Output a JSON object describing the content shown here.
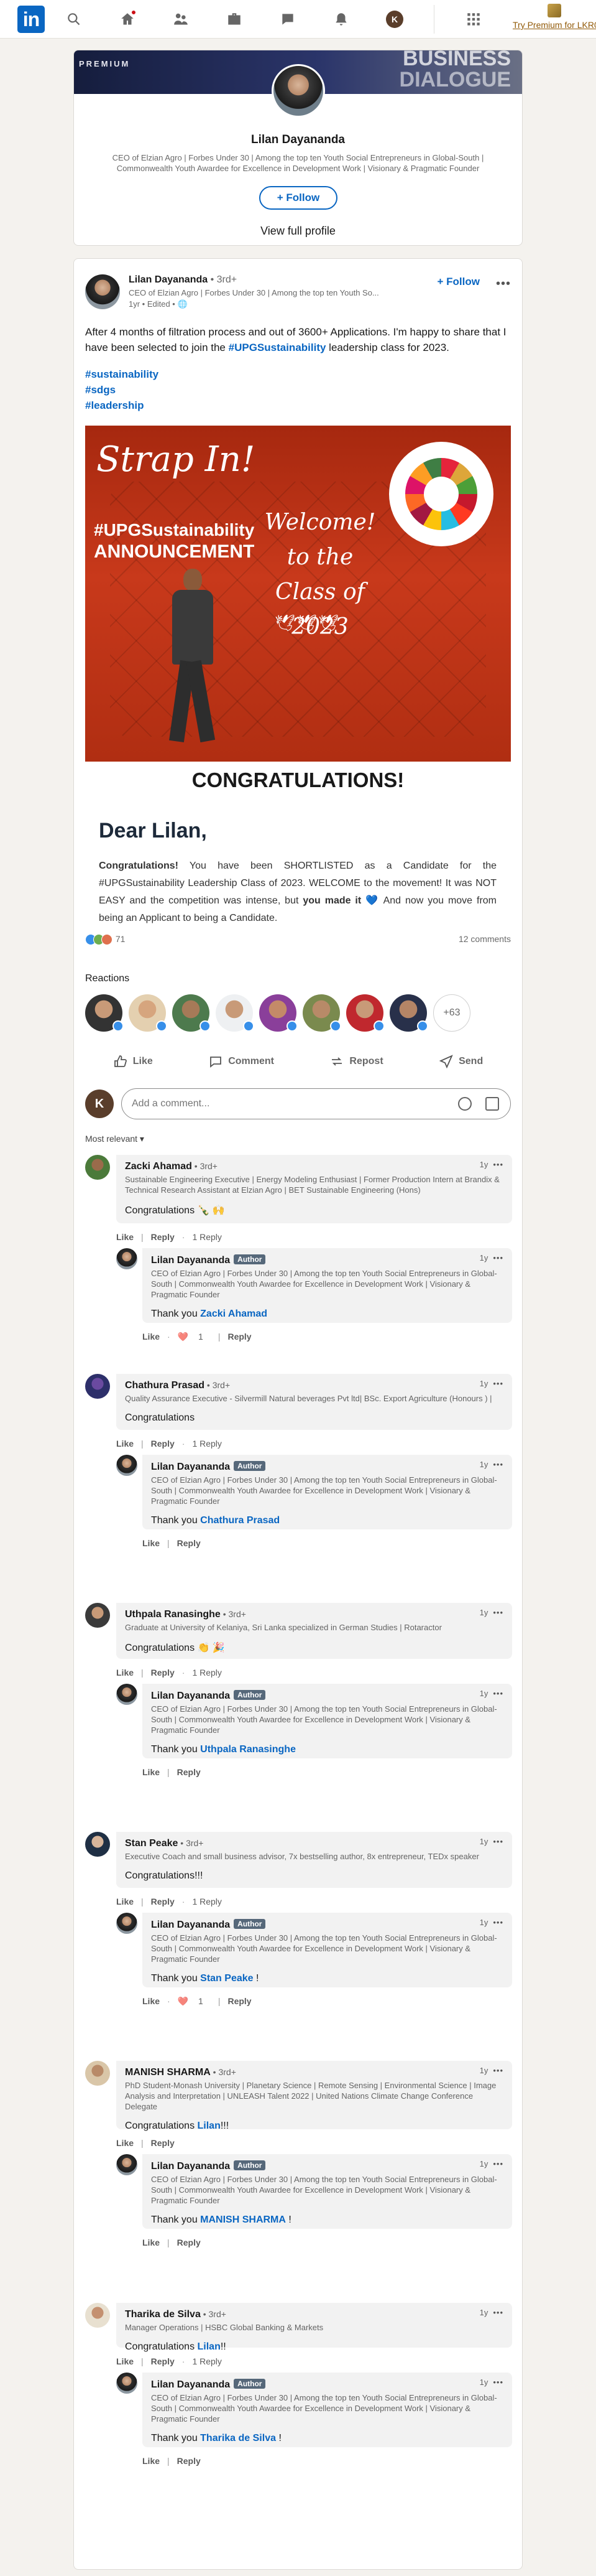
{
  "nav": {
    "logo": "in",
    "me_initial": "K",
    "premium": "Try Premium for LKR0",
    "icons": [
      "search-icon",
      "home-icon",
      "network-icon",
      "jobs-icon",
      "messaging-icon",
      "notifications-icon",
      "grid-icon"
    ]
  },
  "profile": {
    "banner_premium": "PREMIUM",
    "banner_line1": "BUSINESS",
    "banner_line2": "DIALOGUE",
    "name": "Lilan Dayananda",
    "headline": "CEO of Elzian Agro | Forbes Under 30 | Among the top ten Youth Social Entrepreneurs in Global-South | Commonwealth Youth Awardee for Excellence in Development Work | Visionary & Pragmatic Founder",
    "follow": "+ Follow",
    "view_profile": "View full profile"
  },
  "post": {
    "author": "Lilan Dayananda",
    "degree": " • 3rd+",
    "headline": "CEO of Elzian Agro | Forbes Under 30 | Among the top ten Youth So...",
    "meta": "1yr • Edited • ",
    "follow": "+ Follow",
    "text_before": "After 4 months of filtration process and out of 3600+ Applications. I'm happy to share that I have been selected to join the ",
    "text_tag": "#UPGSustainability",
    "text_after": " leadership class for 2023.",
    "hashtags": [
      "#sustainability",
      "#sdgs",
      "#leadership"
    ],
    "image": {
      "strap": "Strap In!",
      "tag": "#UPGSustainability",
      "announcement": "ANNOUNCEMENT",
      "welcome_1": "Welcome!",
      "welcome_2": "to the",
      "welcome_3": "Class of 2023"
    },
    "congrats": "CONGRATULATIONS!",
    "dear": "Dear Lilan,",
    "letter_bold1": "Congratulations!",
    "letter_1": " You have been SHORTLISTED as a Candidate for the #UPGSustainability Leadership Class of 2023. WELCOME to the movement! It was NOT EASY and the competition was intense, but ",
    "letter_bold2": "you made it",
    "letter_2": " 💙 And now you move from being an Applicant to being a Candidate.",
    "reaction_count": "71",
    "comment_count": "12 comments",
    "reactions_label": "Reactions",
    "reactors_more": "+63",
    "actions": {
      "like": "Like",
      "comment": "Comment",
      "repost": "Repost",
      "send": "Send"
    },
    "comment_placeholder": "Add a comment...",
    "sort": "Most relevant ▾"
  },
  "comments": [
    {
      "name": "Zacki Ahamad",
      "degree": " • 3rd+",
      "time": "1y",
      "headline": "Sustainable Engineering Executive | Energy Modeling Enthusiast | Former Production Intern at Brandix & Technical Research Assistant at Elzian Agro | BET Sustainable Engineering (Hons)",
      "text": "Congratulations 🍾 🙌",
      "like": "Like",
      "reply": "Reply",
      "replies": "1 Reply",
      "reply_item": {
        "name": "Lilan Dayananda",
        "badge": "Author",
        "time": "1y",
        "headline": "CEO of Elzian Agro | Forbes Under 30 | Among the top ten Youth Social Entrepreneurs in Global-South | Commonwealth Youth Awardee for Excellence in Development Work | Visionary & Pragmatic Founder",
        "prefix": "Thank you ",
        "mention": "Zacki Ahamad",
        "suffix": "",
        "like": "Like",
        "react_count": "1",
        "reply": "Reply"
      }
    },
    {
      "name": "Chathura Prasad",
      "degree": " • 3rd+",
      "time": "1y",
      "headline": "Quality Assurance Executive - Silvermill Natural beverages Pvt ltd| BSc. Export Agriculture (Honours ) |",
      "text": "Congratulations",
      "like": "Like",
      "reply": "Reply",
      "replies": "1 Reply",
      "reply_item": {
        "name": "Lilan Dayananda",
        "badge": "Author",
        "time": "1y",
        "headline": "CEO of Elzian Agro | Forbes Under 30 | Among the top ten Youth Social Entrepreneurs in Global-South | Commonwealth Youth Awardee for Excellence in Development Work | Visionary & Pragmatic Founder",
        "prefix": "Thank you ",
        "mention": "Chathura Prasad",
        "suffix": "",
        "like": "Like",
        "react_count": "",
        "reply": "Reply"
      }
    },
    {
      "name": "Uthpala Ranasinghe",
      "degree": " • 3rd+",
      "time": "1y",
      "headline": "Graduate at University of Kelaniya, Sri Lanka specialized in German Studies | Rotaractor",
      "text": "Congratulations 👏 🎉",
      "like": "Like",
      "reply": "Reply",
      "replies": "1 Reply",
      "reply_item": {
        "name": "Lilan Dayananda",
        "badge": "Author",
        "time": "1y",
        "headline": "CEO of Elzian Agro | Forbes Under 30 | Among the top ten Youth Social Entrepreneurs in Global-South | Commonwealth Youth Awardee for Excellence in Development Work | Visionary & Pragmatic Founder",
        "prefix": "Thank you ",
        "mention": "Uthpala Ranasinghe",
        "suffix": "",
        "like": "Like",
        "react_count": "",
        "reply": "Reply"
      }
    },
    {
      "name": "Stan Peake",
      "degree": " • 3rd+",
      "time": "1y",
      "headline": "Executive Coach and small business advisor, 7x bestselling author, 8x entrepreneur, TEDx speaker",
      "text": "Congratulations!!!",
      "like": "Like",
      "reply": "Reply",
      "replies": "1 Reply",
      "reply_item": {
        "name": "Lilan Dayananda",
        "badge": "Author",
        "time": "1y",
        "headline": "CEO of Elzian Agro | Forbes Under 30 | Among the top ten Youth Social Entrepreneurs in Global-South | Commonwealth Youth Awardee for Excellence in Development Work | Visionary & Pragmatic Founder",
        "prefix": "Thank you ",
        "mention": "Stan Peake",
        "suffix": " !",
        "like": "Like",
        "react_count": "1",
        "reply": "Reply"
      }
    },
    {
      "name": "MANISH SHARMA",
      "degree": " • 3rd+",
      "time": "1y",
      "headline": "PhD Student-Monash University | Planetary Science | Remote Sensing | Environmental Science | Image Analysis and Interpretation | UNLEASH Talent 2022 | United Nations Climate Change Conference Delegate",
      "text_prefix": "Congratulations ",
      "text_mention": "Lilan",
      "text_suffix": "!!!",
      "like": "Like",
      "reply": "Reply",
      "replies": "",
      "reply_item": {
        "name": "Lilan Dayananda",
        "badge": "Author",
        "time": "1y",
        "headline": "CEO of Elzian Agro | Forbes Under 30 | Among the top ten Youth Social Entrepreneurs in Global-South | Commonwealth Youth Awardee for Excellence in Development Work | Visionary & Pragmatic Founder",
        "prefix": "Thank you ",
        "mention": "MANISH SHARMA",
        "suffix": " !",
        "like": "Like",
        "react_count": "",
        "reply": "Reply"
      }
    },
    {
      "name": "Tharika de Silva",
      "degree": " • 3rd+",
      "time": "1y",
      "headline": "Manager Operations | HSBC Global Banking & Markets",
      "text_prefix": "Congratulations ",
      "text_mention": "Lilan",
      "text_suffix": "!!",
      "like": "Like",
      "reply": "Reply",
      "replies": "1 Reply",
      "reply_item": {
        "name": "Lilan Dayananda",
        "badge": "Author",
        "time": "1y",
        "headline": "CEO of Elzian Agro | Forbes Under 30 | Among the top ten Youth Social Entrepreneurs in Global-South | Commonwealth Youth Awardee for Excellence in Development Work | Visionary & Pragmatic Founder",
        "prefix": "Thank you ",
        "mention": "Tharika de Silva",
        "suffix": " !",
        "like": "Like",
        "react_count": "",
        "reply": "Reply"
      }
    }
  ],
  "colors": {
    "brand": "#0a66c2",
    "like": "#378fe9",
    "page_bg": "#f4f2ee"
  }
}
